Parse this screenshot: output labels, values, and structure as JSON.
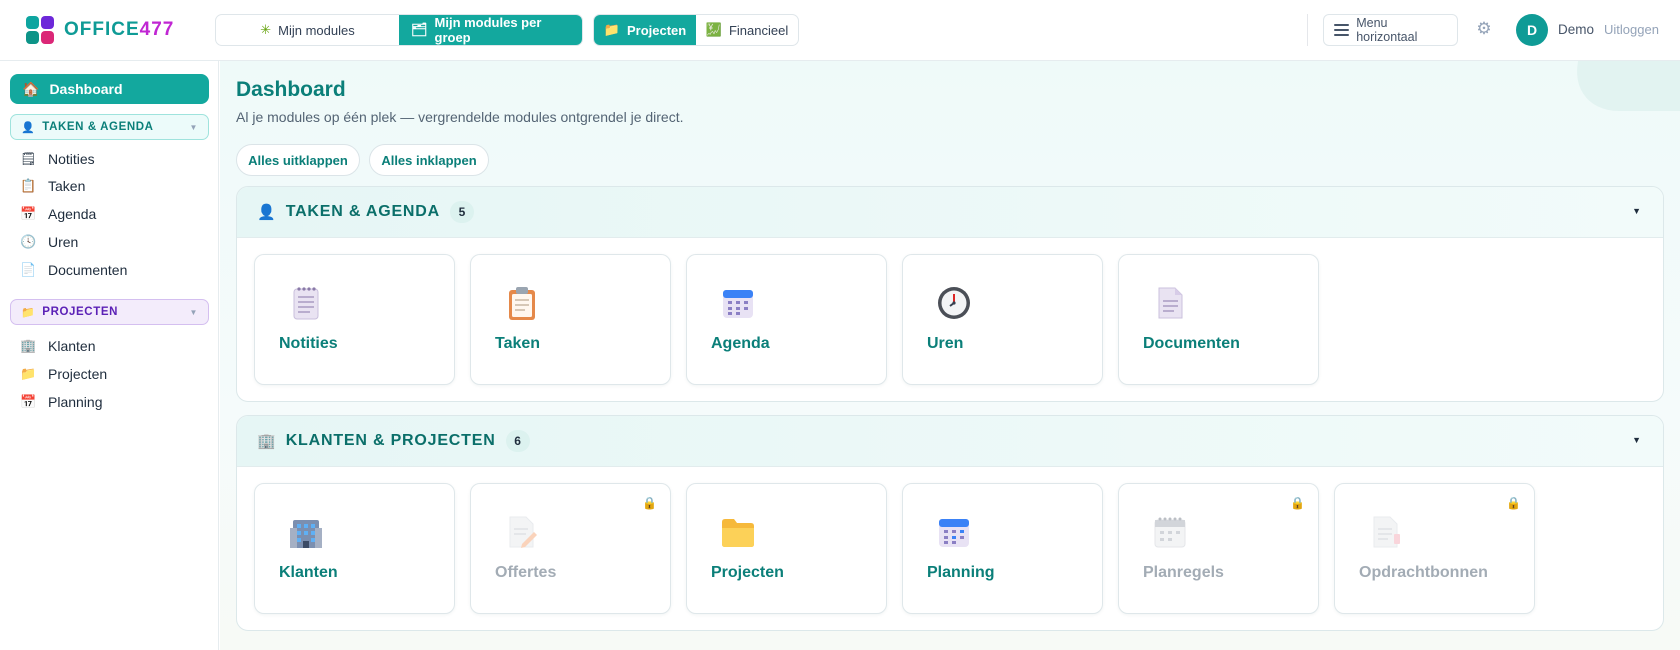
{
  "brand": {
    "name_main": "OFFICE",
    "name_accent": "477"
  },
  "topnav": {
    "group1": [
      {
        "label": "Mijn modules",
        "icon": "puzzle-icon",
        "glyph": "✳",
        "active": false
      },
      {
        "label": "Mijn modules per groep",
        "icon": "folder-icon",
        "glyph": "🗂",
        "active": true
      }
    ],
    "group2": [
      {
        "label": "Projecten",
        "icon": "folder-icon",
        "glyph": "📁",
        "active": true
      },
      {
        "label": "Financieel",
        "icon": "finance-icon",
        "glyph": "💹",
        "active": false
      }
    ],
    "menu_label": "Menu horizontaal",
    "avatar_initial": "D",
    "user_name": "Demo",
    "logout_label": "Uitloggen"
  },
  "sidebar": {
    "dashboard_label": "Dashboard",
    "groups": [
      {
        "label": "TAKEN & AGENDA",
        "items": [
          "Notities",
          "Taken",
          "Agenda",
          "Uren",
          "Documenten"
        ]
      },
      {
        "label": "PROJECTEN",
        "items": [
          "Klanten",
          "Projecten",
          "Planning"
        ]
      }
    ]
  },
  "main": {
    "title": "Dashboard",
    "subtitle": "Al je modules op één plek — vergrendelde modules ontgrendel je direct.",
    "expand_all": "Alles uitklappen",
    "collapse_all": "Alles inklappen",
    "sections": [
      {
        "title": "TAKEN & AGENDA",
        "count": "5",
        "cards": [
          {
            "label": "Notities",
            "icon": "notepad-icon",
            "locked": false
          },
          {
            "label": "Taken",
            "icon": "clipboard-icon",
            "locked": false
          },
          {
            "label": "Agenda",
            "icon": "calendar-icon",
            "locked": false
          },
          {
            "label": "Uren",
            "icon": "clock-icon",
            "locked": false
          },
          {
            "label": "Documenten",
            "icon": "document-icon",
            "locked": false
          }
        ]
      },
      {
        "title": "KLANTEN & PROJECTEN",
        "count": "6",
        "cards": [
          {
            "label": "Klanten",
            "icon": "building-icon",
            "locked": false
          },
          {
            "label": "Offertes",
            "icon": "quote-document-icon",
            "locked": true
          },
          {
            "label": "Projecten",
            "icon": "folder-icon",
            "locked": false
          },
          {
            "label": "Planning",
            "icon": "calendar-icon",
            "locked": false
          },
          {
            "label": "Planregels",
            "icon": "spiral-calendar-icon",
            "locked": true
          },
          {
            "label": "Opdrachtbonnen",
            "icon": "order-document-icon",
            "locked": true
          }
        ]
      }
    ]
  },
  "colors": {
    "accent": "#13a89e",
    "title": "#0b7f79",
    "lock": "#e0a93a"
  }
}
